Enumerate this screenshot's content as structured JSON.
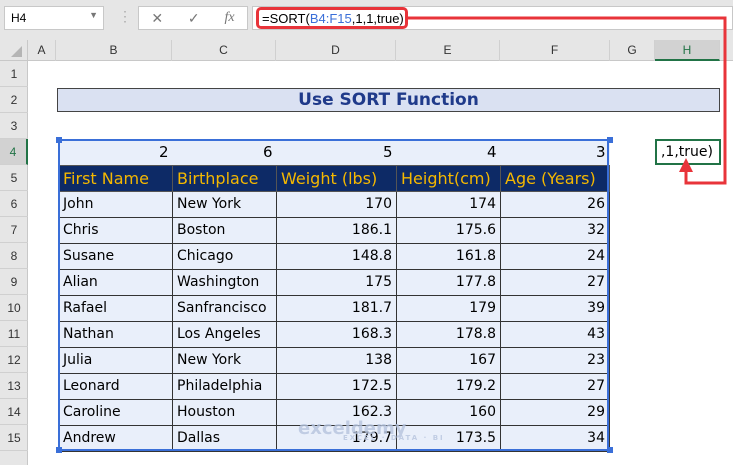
{
  "name_box": "H4",
  "formula_bar": {
    "prefix": "=SORT(",
    "ref": "B4:F15",
    "suffix": ",1,1,true)",
    "cancel_icon": "✕",
    "enter_icon": "✓",
    "fx_icon": "fx"
  },
  "columns": [
    "A",
    "B",
    "C",
    "D",
    "E",
    "F",
    "G",
    "H"
  ],
  "rows": [
    "1",
    "2",
    "3",
    "4",
    "5",
    "6",
    "7",
    "8",
    "9",
    "10",
    "11",
    "12",
    "13",
    "14",
    "15"
  ],
  "title": "Use SORT Function",
  "row4": [
    "2",
    "6",
    "5",
    "4",
    "3"
  ],
  "headers": [
    "First Name",
    "Birthplace",
    "Weight (lbs)",
    "Height(cm)",
    "Age (Years)"
  ],
  "data": [
    [
      "John",
      "New York",
      "170",
      "174",
      "26"
    ],
    [
      "Chris",
      "Boston",
      "186.1",
      "175.6",
      "32"
    ],
    [
      "Susane",
      "Chicago",
      "148.8",
      "161.8",
      "24"
    ],
    [
      "Alian",
      "Washington",
      "175",
      "177.8",
      "27"
    ],
    [
      "Rafael",
      "Sanfrancisco",
      "181.7",
      "179",
      "39"
    ],
    [
      "Nathan",
      "Los Angeles",
      "168.3",
      "178.8",
      "43"
    ],
    [
      "Julia",
      "New York",
      "138",
      "167",
      "23"
    ],
    [
      "Leonard",
      "Philadelphia",
      "172.5",
      "179.2",
      "27"
    ],
    [
      "Caroline",
      "Houston",
      "162.3",
      "160",
      "29"
    ],
    [
      "Andrew",
      "Dallas",
      "179.7",
      "173.5",
      "34"
    ]
  ],
  "h4_value": ",1,true)",
  "watermark": {
    "name": "exceldemy",
    "tagline": "EXCEL · DATA · BI"
  },
  "colors": {
    "header_bg": "#0d2a66",
    "header_text": "#f5b800",
    "cell_bg": "#e9effa",
    "annotation": "#e8343a",
    "selection": "#3a6fd8"
  }
}
